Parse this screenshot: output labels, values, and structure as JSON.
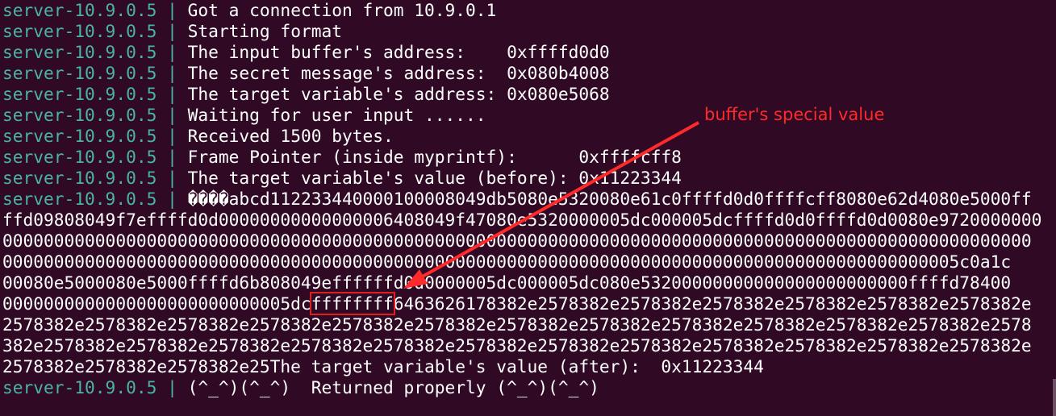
{
  "terminal": {
    "host_lines": [
      {
        "host": "server-10.9.0.5",
        "sep": "|",
        "text": " Got a connection from 10.9.0.1"
      },
      {
        "host": "server-10.9.0.5",
        "sep": "|",
        "text": " Starting format"
      },
      {
        "host": "server-10.9.0.5",
        "sep": "|",
        "text": " The input buffer's address:    0xffffd0d0"
      },
      {
        "host": "server-10.9.0.5",
        "sep": "|",
        "text": " The secret message's address:  0x080b4008"
      },
      {
        "host": "server-10.9.0.5",
        "sep": "|",
        "text": " The target variable's address: 0x080e5068"
      },
      {
        "host": "server-10.9.0.5",
        "sep": "|",
        "text": " Waiting for user input ......"
      },
      {
        "host": "server-10.9.0.5",
        "sep": "|",
        "text": " Received 1500 bytes."
      },
      {
        "host": "server-10.9.0.5",
        "sep": "|",
        "text": " Frame Pointer (inside myprintf):      0xffffcff8"
      },
      {
        "host": "server-10.9.0.5",
        "sep": "|",
        "text": " The target variable's value (before): 0x11223344"
      },
      {
        "host": "server-10.9.0.5",
        "sep": "|",
        "text": " ����abcd112233440000100008049db5080e5320080e61c0ffffd0d0ffffcff8080e62d4080e5000ff"
      }
    ],
    "dump_lines": [
      "ffd09808049f7effffd0d00000000000000006408049f47080e5320000005dc000005dcffffd0d0ffffd0d0080e9720000000",
      "0000000000000000000000000000000000000000000000000000000000000000000000000000000000000000000000000000",
      "000000000000000000000000000000000000000000000000000000000000000000000000000000000000000000005c0a1c",
      "00080e5000080e5000ffffd6b808049effffffd0d0000005dc000005dc080e53200000000000000000000000ffffd78400"
    ],
    "highlight_line": {
      "before": "0000000000000000000000000005dc",
      "highlight": "ffffffff",
      "after": "6463626178382e2578382e2578382e2578382e2578382e2578382e2578382e"
    },
    "dump_lines_2": [
      "2578382e2578382e2578382e2578382e2578382e2578382e2578382e2578382e2578382e2578382e2578382e2578382e2578",
      "382e2578382e2578382e2578382e2578382e2578382e2578382e2578382e2578382e2578382e2578382e2578382e2578382e"
    ],
    "after_line": "2578382e2578382e2578382e25The target variable's value (after):  0x11223344",
    "final_line": {
      "host": "server-10.9.0.5",
      "sep": "|",
      "text": " (^_^)(^_^)  Returned properly (^_^)(^_^)"
    }
  },
  "annotation": {
    "label": "buffer's special value",
    "color": "#ff2a2a"
  },
  "colors": {
    "background": "#300a24",
    "host": "#4bb3a6",
    "text": "#ffffff"
  }
}
